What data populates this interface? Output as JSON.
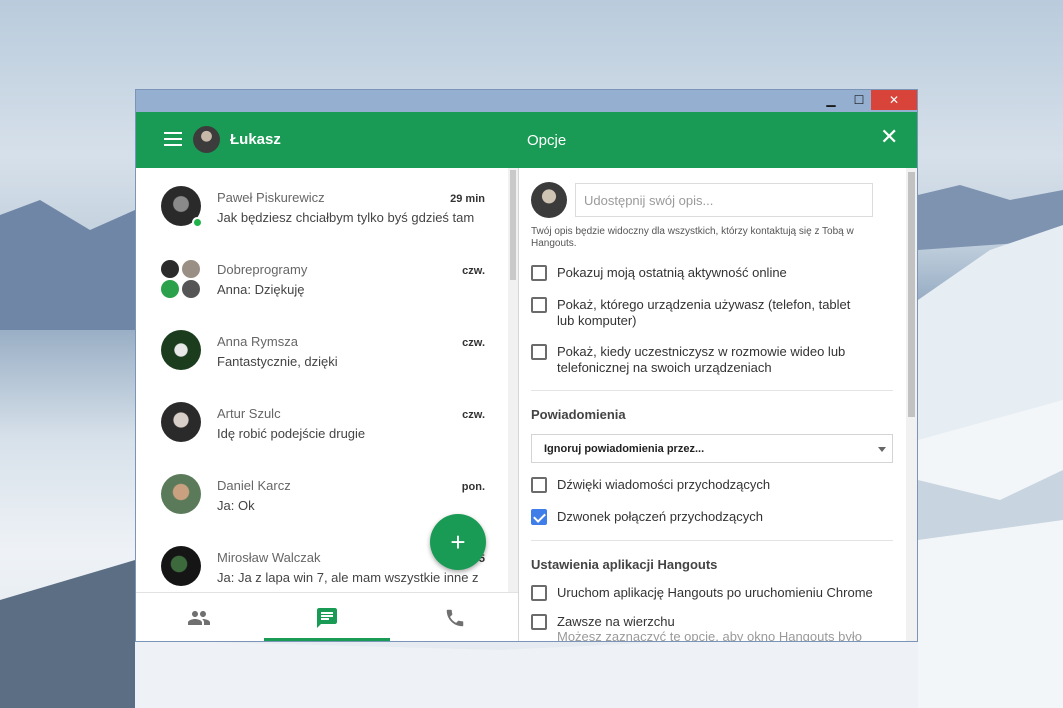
{
  "window": {
    "minimize": "▁",
    "maximize": "☐",
    "close": "✕"
  },
  "appbar": {
    "user_name": "Łukasz",
    "title": "Opcje",
    "close_icon": "✕"
  },
  "conversations": [
    {
      "name": "Paweł Piskurewicz",
      "message": "Jak będziesz chciałbym tylko byś gdzieś tam",
      "time": "29 min",
      "online": true
    },
    {
      "name": "Dobreprogramy",
      "message": "Anna: Dziękuję",
      "time": "czw.",
      "group": true
    },
    {
      "name": "Anna Rymsza",
      "message": "Fantastycznie, dzięki",
      "time": "czw."
    },
    {
      "name": "Artur Szulc",
      "message": "Idę robić podejście drugie",
      "time": "czw."
    },
    {
      "name": "Daniel Karcz",
      "message": "Ja: Ok",
      "time": "pon."
    },
    {
      "name": "Mirosław Walczak",
      "message": "Ja: Ja z lapa win 7, ale mam wszystkie inne z",
      "time": "05"
    }
  ],
  "fab_label": "+",
  "bottom_nav": [
    "contacts-icon",
    "messages-icon",
    "phone-icon"
  ],
  "options": {
    "description_placeholder": "Udostępnij swój opis...",
    "description_hint": "Twój opis będzie widoczny dla wszystkich, którzy kontaktują się z Tobą w Hangouts.",
    "privacy": [
      {
        "label": "Pokazuj moją ostatnią aktywność online",
        "checked": false
      },
      {
        "label": "Pokaż, którego urządzenia używasz (telefon, tablet lub komputer)",
        "checked": false
      },
      {
        "label": "Pokaż, kiedy uczestniczysz w rozmowie wideo lub telefonicznej na swoich urządzeniach",
        "checked": false
      }
    ],
    "notifications_title": "Powiadomienia",
    "ignore_select": "Ignoruj powiadomienia przez...",
    "notifications": [
      {
        "label": "Dźwięki wiadomości przychodzących",
        "checked": false
      },
      {
        "label": "Dzwonek połączeń przychodzących",
        "checked": true
      }
    ],
    "app_settings_title": "Ustawienia aplikacji Hangouts",
    "app_settings": [
      {
        "label": "Uruchom aplikację Hangouts po uruchomieniu Chrome",
        "checked": false
      },
      {
        "label": "Zawsze na wierzchu",
        "sub": "Możesz zaznaczyć tę opcję, aby okno Hangouts było",
        "checked": false
      }
    ]
  }
}
